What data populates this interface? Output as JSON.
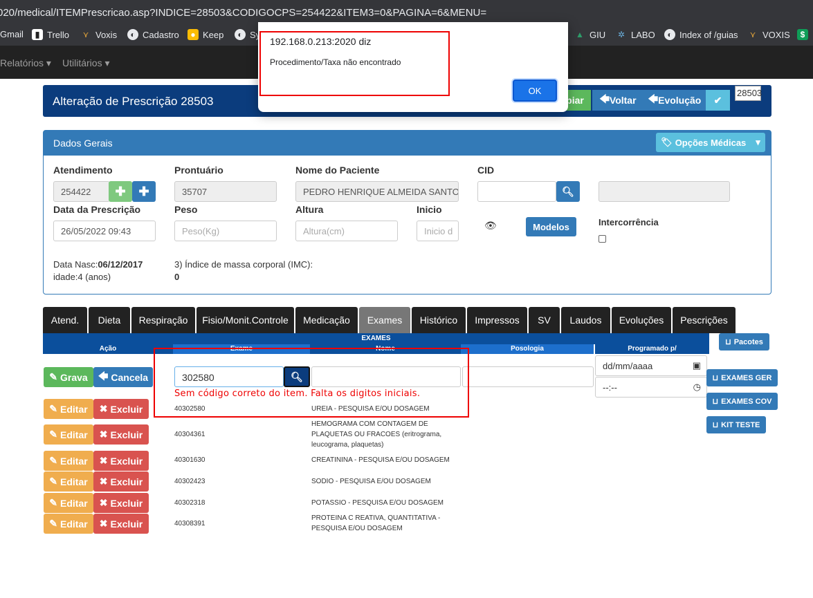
{
  "browser": {
    "url": "020/medical/ITEMPrescricao.asp?INDICE=28503&CODIGOCPS=254422&ITEM3=0&PAGINA=6&MENU=",
    "bookmarks": [
      "Gmail",
      "Trello",
      "Voxis",
      "Cadastro",
      "Keep",
      "Sy",
      "GIU",
      "LABO",
      "Index of /guias",
      "VOXIS"
    ]
  },
  "navbar": {
    "items": [
      "Relatórios",
      "Utilitários"
    ]
  },
  "title_panel": {
    "title": "Alteração de Prescrição 28503",
    "copy_label": "piar",
    "back_label": "Voltar",
    "evolution_label": "Evolução",
    "check_label": "✔",
    "side_tag": "28503"
  },
  "dados_gerais": {
    "heading": "Dados Gerais",
    "opcoes_label": "Opções Médicas",
    "atendimento_label": "Atendimento",
    "atendimento_value": "254422",
    "prontuario_label": "Prontuário",
    "prontuario_value": "35707",
    "nome_label": "Nome do Paciente",
    "nome_value": "PEDRO HENRIQUE ALMEIDA SANTOS",
    "cid_label": "CID",
    "data_label": "Data da Prescrição",
    "data_value": "26/05/2022 09:43",
    "peso_label": "Peso",
    "peso_placeholder": "Peso(Kg)",
    "altura_label": "Altura",
    "altura_placeholder": "Altura(cm)",
    "inicio_label": "Inicio",
    "inicio_placeholder": "Inicio d",
    "modelos_label": "Modelos",
    "intercorrencia_label": "Intercorrência",
    "nasc_label": "Data Nasc:",
    "nasc_value": "06/12/2017",
    "idade_text": "idade:4 (anos)",
    "imc_label": "3) Índice de massa corporal (IMC):",
    "imc_value": "0"
  },
  "tabs": [
    "Atend.",
    "Dieta",
    "Respiração",
    "Fisio/Monit.Controle",
    "Medicação",
    "Exames",
    "Histórico",
    "Impressos",
    "SV",
    "Laudos",
    "Evoluções",
    "Pescrições"
  ],
  "exames": {
    "header": "EXAMES",
    "columns": [
      "Ação",
      "Exame",
      "Nome",
      "Posologia",
      "Programado p/"
    ],
    "grava_label": "Grava",
    "cancela_label": "Cancela",
    "code_value": "302580",
    "date_placeholder": "dd/mm/aaaa",
    "time_placeholder": "--:--",
    "error_text": "Sem código correto do item. Falta os digitos iniciais.",
    "editar_label": "Editar",
    "excluir_label": "Excluir",
    "rows": [
      {
        "code": "40302580",
        "name": "UREIA - PESQUISA E/OU DOSAGEM"
      },
      {
        "code": "40304361",
        "name": "HEMOGRAMA COM CONTAGEM DE PLAQUETAS OU FRACOES (eritrograma, leucograma, plaquetas)"
      },
      {
        "code": "40301630",
        "name": "CREATININA - PESQUISA E/OU DOSAGEM"
      },
      {
        "code": "40302423",
        "name": "SODIO - PESQUISA E/OU DOSAGEM"
      },
      {
        "code": "40302318",
        "name": "POTASSIO - PESQUISA E/OU DOSAGEM"
      },
      {
        "code": "40308391",
        "name": "PROTEINA C REATIVA, QUANTITATIVA - PESQUISA E/OU DOSAGEM"
      }
    ],
    "side_buttons": [
      "Pacotes",
      "EXAMES GER",
      "EXAMES COV",
      "KIT TESTE"
    ]
  },
  "dialog": {
    "title": "192.168.0.213:2020 diz",
    "message": "Procedimento/Taxa não encontrado",
    "ok_label": "OK"
  },
  "colors": {
    "primary": "#337ab7",
    "title_bg": "#0b3c7d",
    "error": "#e00000",
    "dialog_ok": "#1a73e8"
  }
}
